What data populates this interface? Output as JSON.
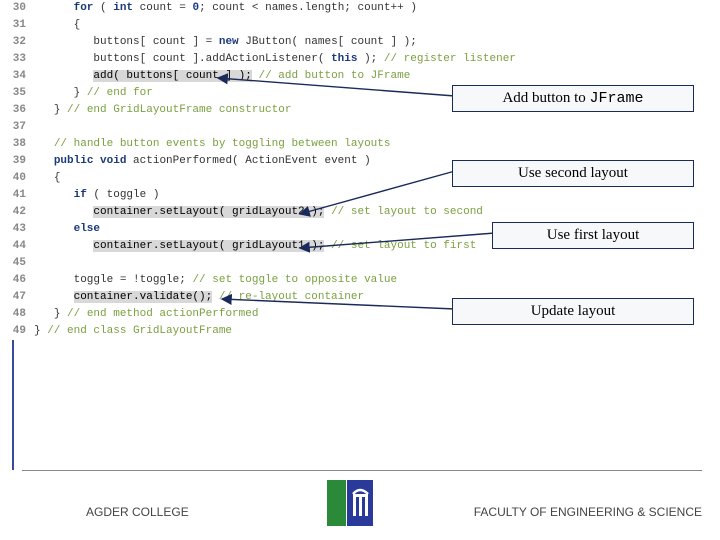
{
  "code": {
    "lines": [
      {
        "n": "30",
        "indent": 6,
        "tokens": [
          [
            "kw",
            "for"
          ],
          [
            "plain",
            " ( "
          ],
          [
            "kw",
            "int"
          ],
          [
            "plain",
            " count = "
          ],
          [
            "num",
            "0"
          ],
          [
            "plain",
            "; count < names.length; count++ )"
          ]
        ]
      },
      {
        "n": "31",
        "indent": 6,
        "tokens": [
          [
            "plain",
            "{"
          ]
        ]
      },
      {
        "n": "32",
        "indent": 9,
        "tokens": [
          [
            "plain",
            "buttons[ count ] = "
          ],
          [
            "kw",
            "new"
          ],
          [
            "plain",
            " JButton( names[ count ] );"
          ]
        ]
      },
      {
        "n": "33",
        "indent": 9,
        "tokens": [
          [
            "plain",
            "buttons[ count ].addActionListener( "
          ],
          [
            "kw",
            "this"
          ],
          [
            "plain",
            " ); "
          ],
          [
            "comment",
            "// register listener"
          ]
        ]
      },
      {
        "n": "34",
        "indent": 9,
        "tokens": [
          [
            "hl",
            "add( buttons[ count ] );"
          ],
          [
            "plain",
            " "
          ],
          [
            "comment",
            "// add button to JFrame"
          ]
        ]
      },
      {
        "n": "35",
        "indent": 6,
        "tokens": [
          [
            "plain",
            "} "
          ],
          [
            "comment",
            "// end for"
          ]
        ]
      },
      {
        "n": "36",
        "indent": 3,
        "tokens": [
          [
            "plain",
            "} "
          ],
          [
            "comment",
            "// end GridLayoutFrame constructor"
          ]
        ]
      },
      {
        "n": "37",
        "indent": 0,
        "tokens": []
      },
      {
        "n": "38",
        "indent": 3,
        "tokens": [
          [
            "comment",
            "// handle button events by toggling between layouts"
          ]
        ]
      },
      {
        "n": "39",
        "indent": 3,
        "tokens": [
          [
            "kw",
            "public"
          ],
          [
            "plain",
            " "
          ],
          [
            "kw",
            "void"
          ],
          [
            "plain",
            " actionPerformed( ActionEvent event )"
          ]
        ]
      },
      {
        "n": "40",
        "indent": 3,
        "tokens": [
          [
            "plain",
            "{"
          ]
        ]
      },
      {
        "n": "41",
        "indent": 6,
        "tokens": [
          [
            "kw",
            "if"
          ],
          [
            "plain",
            " ( toggle )"
          ]
        ]
      },
      {
        "n": "42",
        "indent": 9,
        "tokens": [
          [
            "hl",
            "container.setLayout( gridLayout2 );"
          ],
          [
            "plain",
            " "
          ],
          [
            "comment",
            "// set layout to second"
          ]
        ]
      },
      {
        "n": "43",
        "indent": 6,
        "tokens": [
          [
            "kw",
            "else"
          ]
        ]
      },
      {
        "n": "44",
        "indent": 9,
        "tokens": [
          [
            "hl",
            "container.setLayout( gridLayout1 );"
          ],
          [
            "plain",
            " "
          ],
          [
            "comment",
            "// set layout to first"
          ]
        ]
      },
      {
        "n": "45",
        "indent": 0,
        "tokens": []
      },
      {
        "n": "46",
        "indent": 6,
        "tokens": [
          [
            "plain",
            "toggle = !toggle; "
          ],
          [
            "comment",
            "// set toggle to opposite value"
          ]
        ]
      },
      {
        "n": "47",
        "indent": 6,
        "tokens": [
          [
            "hl",
            "container.validate();"
          ],
          [
            "plain",
            " "
          ],
          [
            "comment",
            "// re-layout container"
          ]
        ]
      },
      {
        "n": "48",
        "indent": 3,
        "tokens": [
          [
            "plain",
            "} "
          ],
          [
            "comment",
            "// end method actionPerformed"
          ]
        ]
      },
      {
        "n": "49",
        "indent": 0,
        "tokens": [
          [
            "plain",
            "} "
          ],
          [
            "comment",
            "// end class GridLayoutFrame"
          ]
        ]
      }
    ]
  },
  "callouts": {
    "c1_a": "Add button to ",
    "c1_b": "JFrame",
    "c2": "Use second layout",
    "c3": "Use first layout",
    "c4": "Update layout"
  },
  "footer": {
    "left": "AGDER COLLEGE",
    "right": "FACULTY OF ENGINEERING & SCIENCE"
  }
}
